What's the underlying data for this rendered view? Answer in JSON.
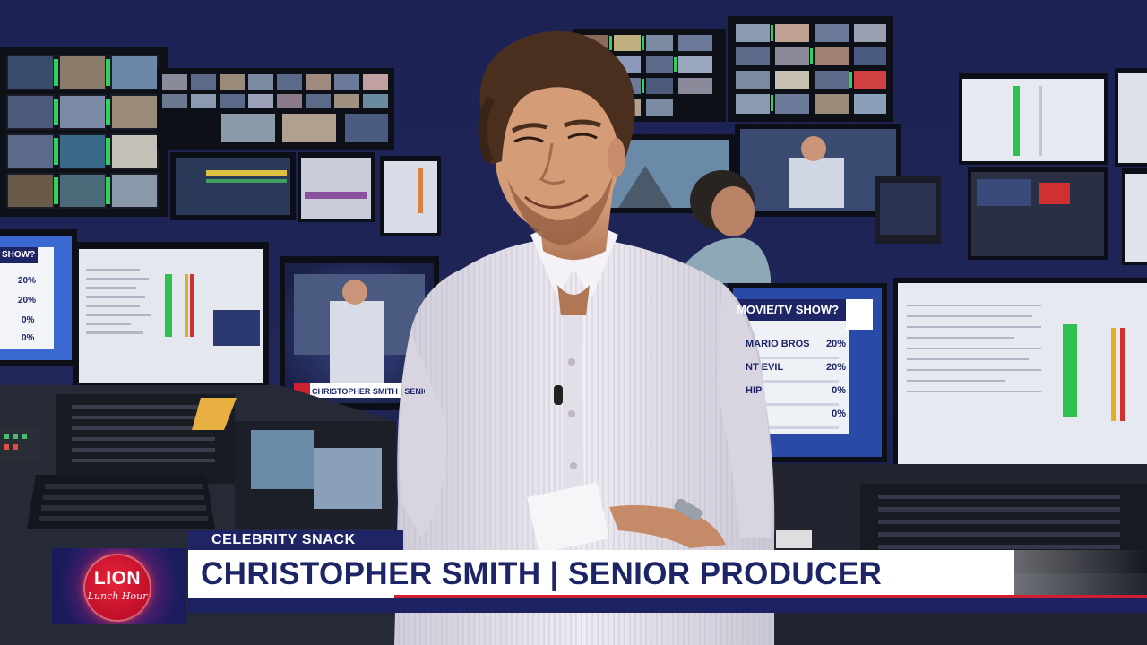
{
  "lower_third": {
    "logo": {
      "wordmark": "LION",
      "script": "Lunch Hour"
    },
    "segment_tag": "CELEBRITY SNACK",
    "name_title": "CHRISTOPHER SMITH | SENIOR PRODUCER"
  },
  "background_monitor_poll": {
    "title": "MOVIE/TV SHOW?",
    "rows": [
      {
        "label": "MARIO BROS",
        "value": "20%"
      },
      {
        "label": "NT EVIL",
        "value": "20%"
      },
      {
        "label": "HIP",
        "value": "0%"
      },
      {
        "label": "",
        "value": "0%"
      }
    ]
  },
  "background_monitor_left_poll": {
    "title": "SHOW?",
    "values": [
      "20%",
      "20%",
      "0%",
      "0%"
    ]
  },
  "background_monitor_preview_tag": "CHRISTOPHER SMITH | SENIOR PRODUC",
  "colors": {
    "brand_navy": "#1d2566",
    "brand_red": "#d0202e",
    "room_wall": "#1b2050",
    "shirt": "#e9e6ee"
  }
}
